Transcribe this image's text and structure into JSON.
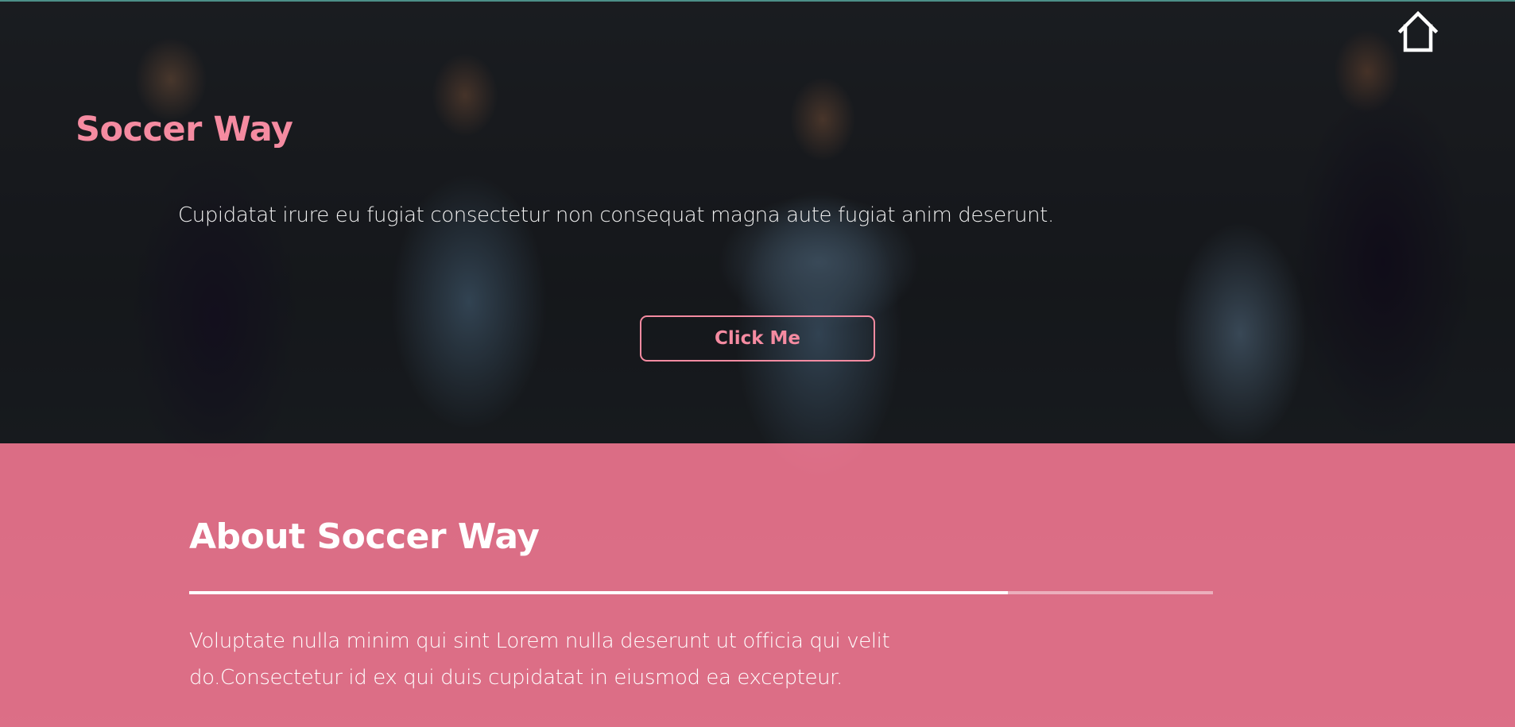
{
  "hero": {
    "title": "Soccer Way",
    "text": "Cupidatat irure eu fugiat consectetur non consequat magna aute fugiat anim deserunt.",
    "button_label": "Click Me",
    "home_icon": "home-icon"
  },
  "about": {
    "title": "About Soccer Way",
    "progress_fraction": 0.8,
    "text": "Voluptate nulla minim qui sint Lorem nulla deserunt ut officia qui velit do.Consectetur id ex qui duis cupidatat in eiusmod ea excepteur."
  },
  "colors": {
    "accent": "#f58ba1",
    "about_background": "#f2748e",
    "text_light": "#ffffff"
  }
}
